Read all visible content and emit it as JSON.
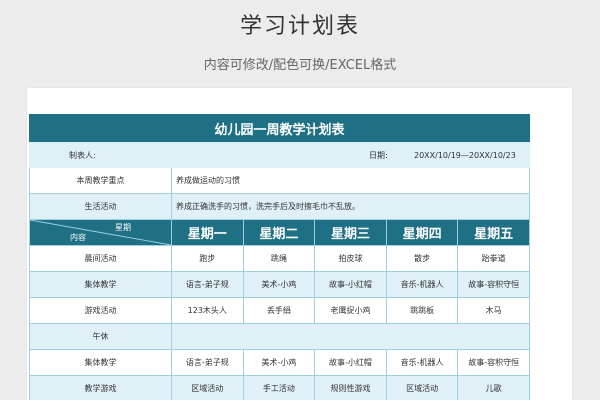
{
  "header": {
    "title": "学习计划表",
    "subtitle": "内容可修改/配色可换/EXCEL格式"
  },
  "plan": {
    "title": "幼儿园一周教学计划表",
    "maker_label": "制表人:",
    "date_label": "日期:",
    "date_value": "20XX/10/19—20XX/10/23",
    "weekly_focus": {
      "label": "本周教学重点",
      "value": "养成做运动的习惯"
    },
    "life_activity": {
      "label": "生活活动",
      "value": "养成正确洗手的习惯，洗完手后及时擦毛巾不乱放。"
    },
    "corner": {
      "top": "星期",
      "bottom": "内容"
    },
    "days": [
      "星期一",
      "星期二",
      "星期三",
      "星期四",
      "星期五"
    ],
    "rows": [
      {
        "label": "晨间活动",
        "cells": [
          "跑步",
          "跳绳",
          "拍皮球",
          "散步",
          "跆拳道"
        ]
      },
      {
        "label": "集体教学",
        "cells": [
          "语言-弟子规",
          "美术-小鸡",
          "故事-小红帽",
          "音乐-机器人",
          "故事-容积守恒"
        ]
      },
      {
        "label": "游戏活动",
        "cells": [
          "123木头人",
          "丢手绢",
          "老鹰捉小鸡",
          "跳跳板",
          "木马"
        ]
      },
      {
        "label": "午休",
        "cells": [
          "",
          "",
          "",
          "",
          ""
        ]
      },
      {
        "label": "集体教学",
        "cells": [
          "语言-弟子规",
          "美术-小鸡",
          "故事-小红帽",
          "音乐-机器人",
          "故事-容积守恒"
        ]
      },
      {
        "label": "教学游戏",
        "cells": [
          "区域活动",
          "手工活动",
          "规则性游戏",
          "区域活动",
          "儿歌"
        ]
      }
    ]
  },
  "colors": {
    "header_blue": "#1f6f85",
    "light_band": "#dff0f7",
    "grid_line": "#9fd0e0"
  }
}
